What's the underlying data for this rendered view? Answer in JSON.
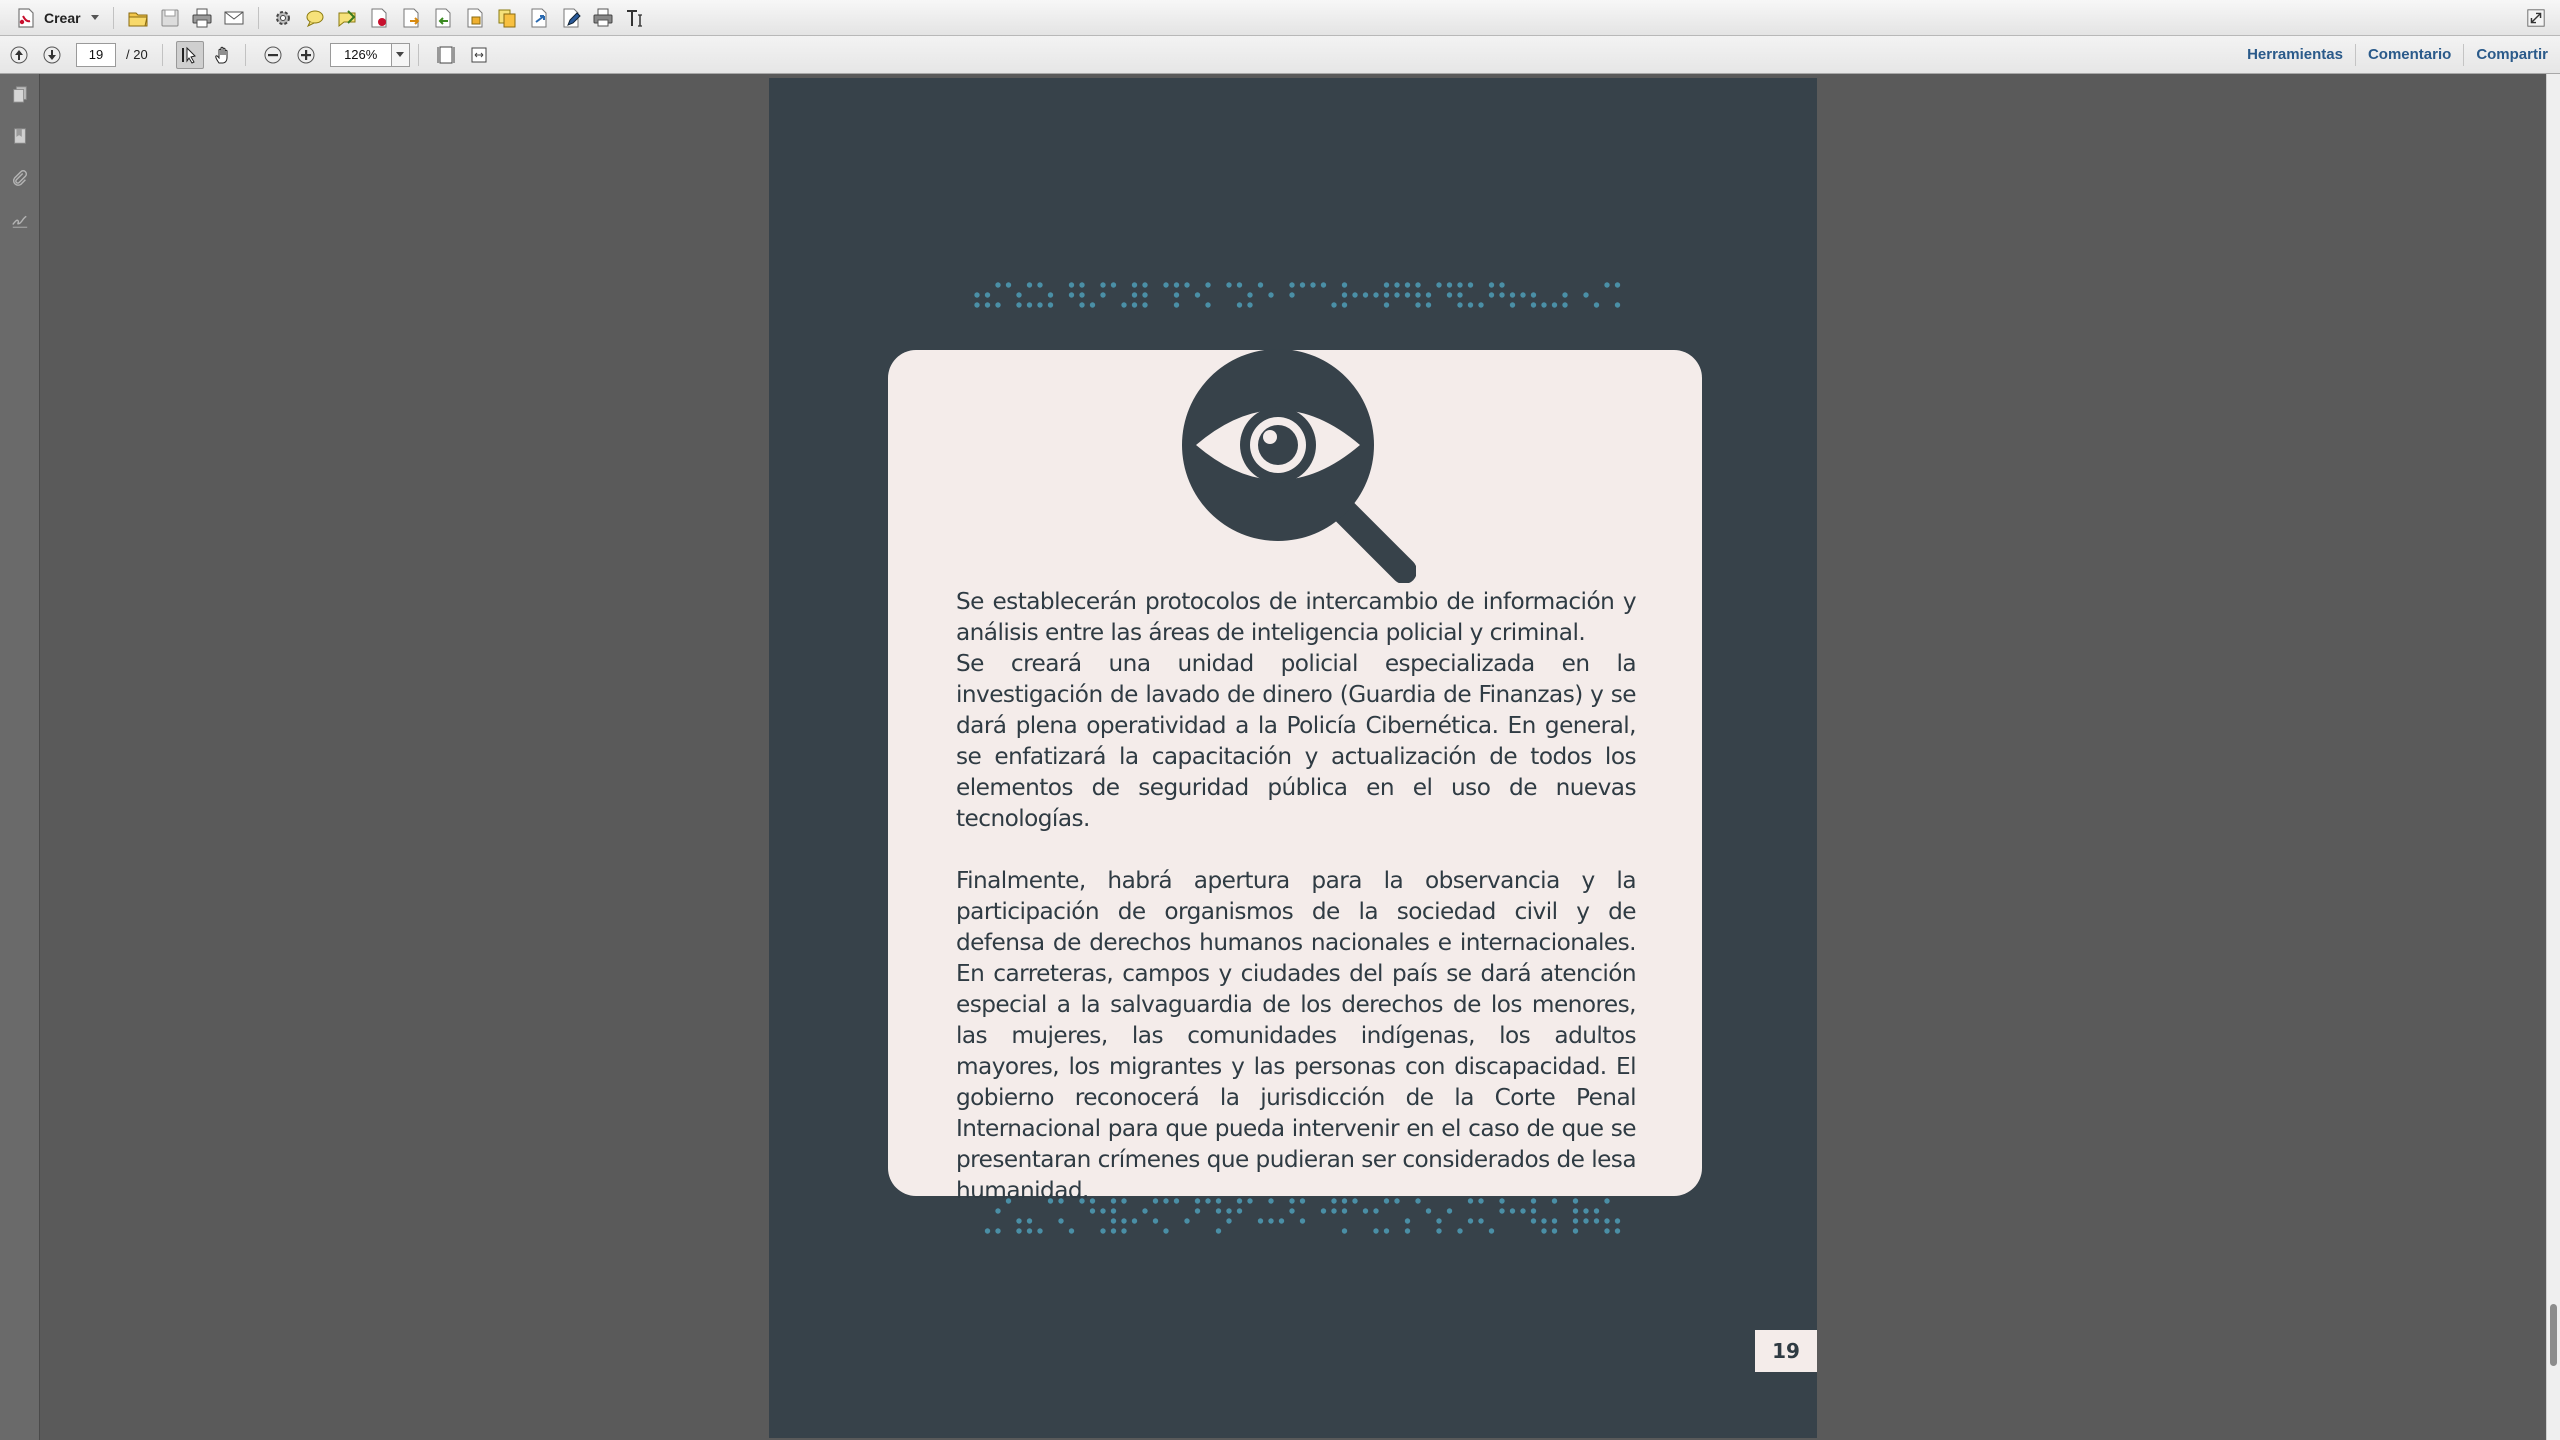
{
  "toolbar": {
    "create_label": "Crear",
    "icons": [
      "open-icon",
      "save-icon",
      "print-icon",
      "email-icon",
      "settings-icon",
      "comment-icon",
      "stamp-icon",
      "pdf-icon",
      "export-icon",
      "import-icon",
      "combine-icon",
      "copy-icon",
      "share-icon",
      "edit-icon",
      "printer-icon",
      "text-tool-icon"
    ]
  },
  "navigation": {
    "current_page": "19",
    "total_pages": "/ 20",
    "zoom": "126%"
  },
  "right_links": {
    "tools": "Herramientas",
    "comment": "Comentario",
    "share": "Compartir"
  },
  "document": {
    "paragraph1": "Se establecerán protocolos de intercambio de información y análisis entre las áreas de inteligencia policial y criminal.",
    "paragraph2": "Se creará una unidad policial especializada en la investigación de lavado de dinero (Guardia de Finanzas) y se dará plena operatividad a la Policía Cibernética. En general, se enfatizará la capacitación y actualización de todos los elementos de seguridad pública en el uso de nuevas tecnologías.",
    "paragraph3": "Finalmente, habrá apertura para la observancia y la participación de organismos de la sociedad civil y de defensa de derechos humanos nacionales e internacionales. En carreteras, campos y ciudades del país se dará atención especial a la salvaguardia de los derechos de los menores, las mujeres, las comunidades indígenas, los adultos mayores, los migrantes y las personas con discapacidad. El gobierno reconocerá la jurisdicción de la Corte Penal Internacional para que pueda intervenir en el caso de que se presentaran crímenes que pudieran ser considerados de lesa humanidad.",
    "page_number": "19"
  },
  "colors": {
    "page_background": "#37424a",
    "card_background": "#f4ecea",
    "dot_accent": "#4a8fa6",
    "text": "#2f3b43",
    "link": "#2a5a8a"
  }
}
